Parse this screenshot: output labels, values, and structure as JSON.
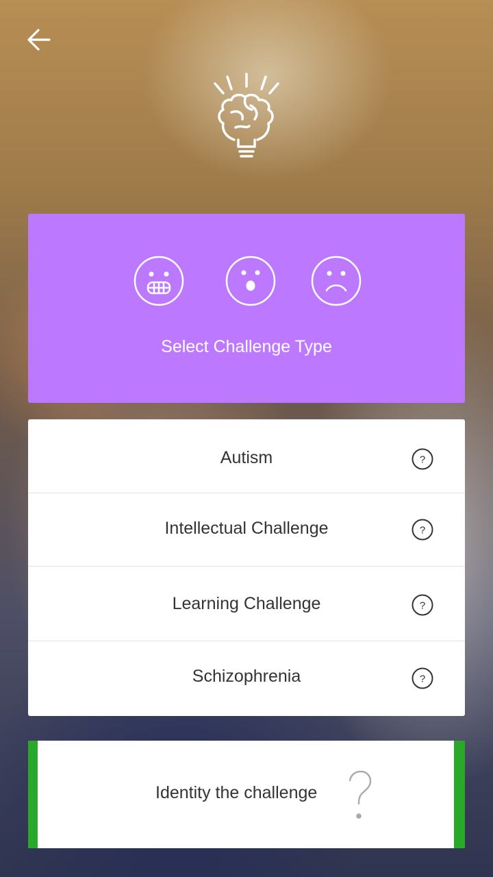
{
  "header": {
    "back_icon": "arrow-left-icon",
    "logo_icon": "brain-lightbulb-icon"
  },
  "challenge_type_card": {
    "title": "Select Challenge Type",
    "background": "#bc79ff",
    "faces": [
      "grin-face-icon",
      "surprised-face-icon",
      "sad-face-icon"
    ]
  },
  "challenges": [
    {
      "label": "Autism",
      "help_icon": "question-circle-icon"
    },
    {
      "label": "Intellectual Challenge",
      "help_icon": "question-circle-icon"
    },
    {
      "label": "Learning Challenge",
      "help_icon": "question-circle-icon"
    },
    {
      "label": "Schizophrenia",
      "help_icon": "question-circle-icon"
    }
  ],
  "identity_button": {
    "label": "Identity the challenge",
    "icon": "question-mark-icon",
    "accent": "#2aa82a"
  }
}
